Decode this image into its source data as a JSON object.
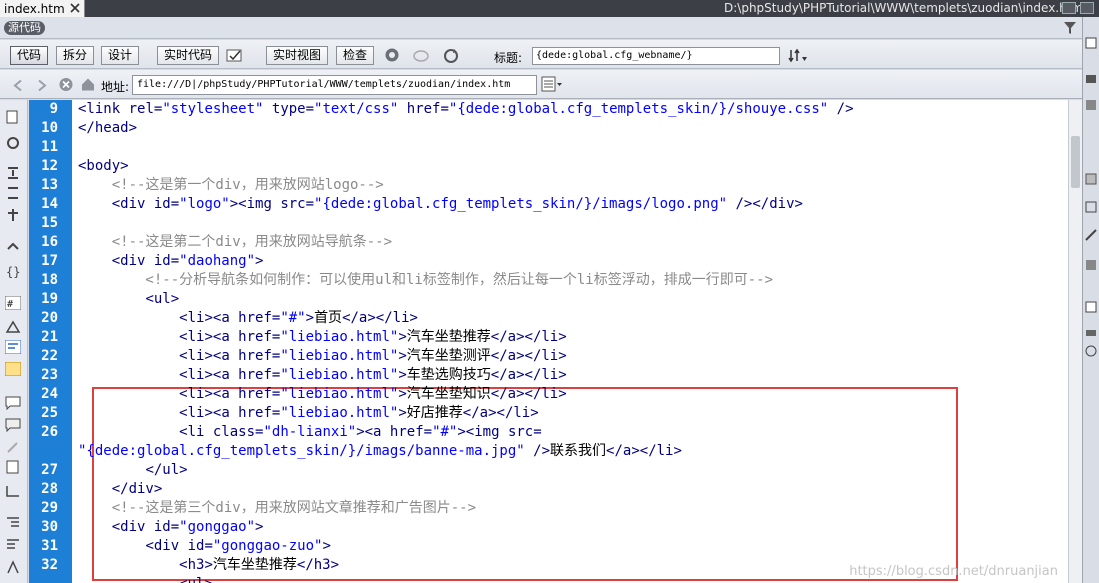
{
  "tab": {
    "name": "index.htm",
    "path": "D:\\phpStudy\\PHPTutorial\\WWW\\templets\\zuodian\\index.htm"
  },
  "source_label": "源代码",
  "toolbar": {
    "code": "代码",
    "split": "拆分",
    "design": "设计",
    "live_code": "实时代码",
    "live_view": "实时视图",
    "inspect": "检查",
    "title_label": "标题:",
    "title_value": "{dede:global.cfg_webname/}"
  },
  "address": {
    "label": "地址:",
    "value": "file:///D|/phpStudy/PHPTutorial/WWW/templets/zuodian/index.htm"
  },
  "watermark": "https://blog.csdn.net/dnruanjian",
  "line_numbers": [
    "9",
    "10",
    "11",
    "12",
    "13",
    "14",
    "15",
    "16",
    "17",
    "18",
    "19",
    "20",
    "21",
    "22",
    "23",
    "24",
    "25",
    "26",
    "",
    "27",
    "28",
    "29",
    "30",
    "31",
    "32",
    ""
  ],
  "code_lines": [
    "<link rel=\"stylesheet\" type=\"text/css\" href=\"{dede:global.cfg_templets_skin/}/shouye.css\" />",
    "</head>",
    "",
    "<body>",
    "    <!--这是第一个div，用来放网站logo-->",
    "    <div id=\"logo\"><img src=\"{dede:global.cfg_templets_skin/}/imags/logo.png\" /></div>",
    "",
    "    <!--这是第二个div，用来放网站导航条-->",
    "    <div id=\"daohang\">",
    "        <!--分析导航条如何制作：可以使用ul和li标签制作，然后让每一个li标签浮动，排成一行即可-->",
    "        <ul>",
    "            <li><a href=\"#\">首页</a></li>",
    "            <li><a href=\"liebiao.html\">汽车坐垫推荐</a></li>",
    "            <li><a href=\"liebiao.html\">汽车坐垫测评</a></li>",
    "            <li><a href=\"liebiao.html\">车垫选购技巧</a></li>",
    "            <li><a href=\"liebiao.html\">汽车坐垫知识</a></li>",
    "            <li><a href=\"liebiao.html\">好店推荐</a></li>",
    "            <li class=\"dh-lianxi\"><a href=\"#\"><img src=",
    "\"{dede:global.cfg_templets_skin/}/imags/banne-ma.jpg\" />联系我们</a></li>",
    "        </ul>",
    "    </div>",
    "    <!--这是第三个div，用来放网站文章推荐和广告图片-->",
    "    <div id=\"gonggao\">",
    "        <div id=\"gonggao-zuo\">",
    "            <h3>汽车坐垫推荐</h3>",
    "            <ul>"
  ]
}
